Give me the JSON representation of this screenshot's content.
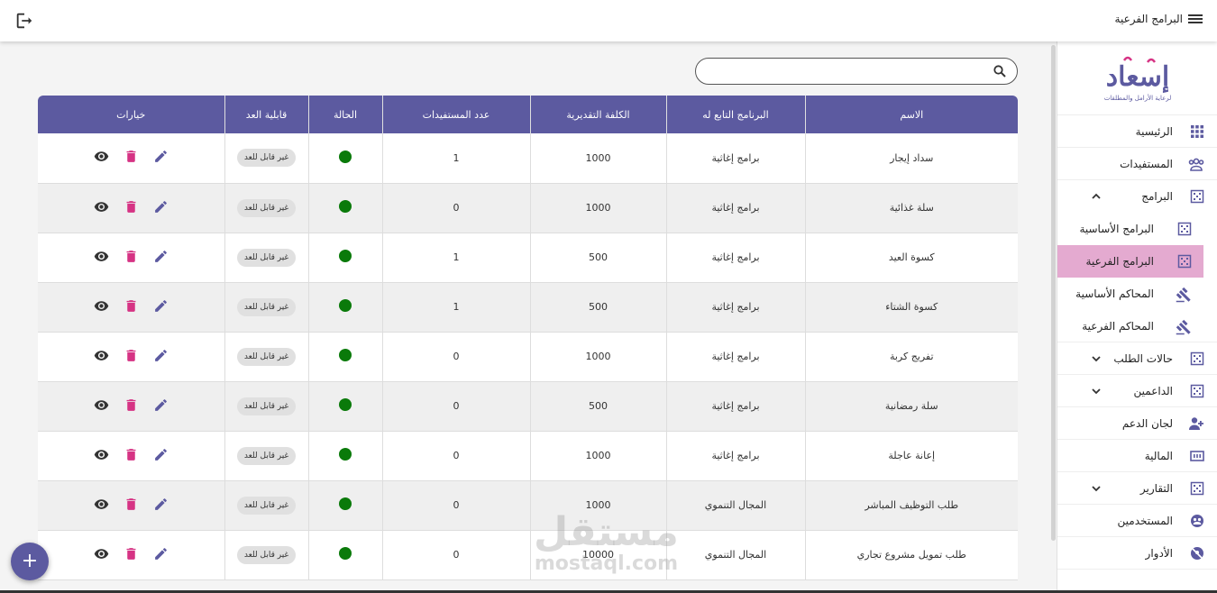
{
  "header": {
    "title": "البرامج الفرعية",
    "menu_icon": "menu-icon",
    "logout_icon": "logout-icon"
  },
  "sidebar": {
    "logo_text": "إسعاد",
    "logo_subtitle": "لرعاية الأرامل والمطلقات",
    "items": [
      {
        "label": "الرئيسية",
        "icon": "apps-grid-icon"
      },
      {
        "label": "المستفيدات",
        "icon": "group-icon"
      },
      {
        "label": "البرامج",
        "icon": "programs-icon"
      },
      {
        "label": "البرامج الأساسية",
        "icon": "programs-icon"
      },
      {
        "label": "البرامج الفرعية",
        "icon": "programs-icon"
      },
      {
        "label": "المحاكم الأساسية",
        "icon": "gavel-icon"
      },
      {
        "label": "المحاكم الفرعية",
        "icon": "gavel-icon"
      },
      {
        "label": "حالات الطلب",
        "icon": "programs-icon"
      },
      {
        "label": "الداعمين",
        "icon": "programs-icon"
      },
      {
        "label": "لجان الدعم",
        "icon": "person-add-icon"
      },
      {
        "label": "المالية",
        "icon": "finance-icon"
      },
      {
        "label": "التقارير",
        "icon": "programs-icon"
      },
      {
        "label": "المستخدمين",
        "icon": "users-icon"
      },
      {
        "label": "الأدوار",
        "icon": "roles-icon"
      }
    ]
  },
  "search": {
    "placeholder": "",
    "value": ""
  },
  "table": {
    "headers": [
      "الاسم",
      "البرنامج التابع له",
      "الكلفة التقديرية",
      "عدد المستفيدات",
      "الحالة",
      "قابلية العد",
      "خيارات"
    ],
    "rows": [
      {
        "name": "سداد إيجار",
        "program": "برامج إغاثية",
        "cost": "1000",
        "beneficiaries": "1",
        "countable": "غير قابل للعد"
      },
      {
        "name": "سلة غذائية",
        "program": "برامج إغاثية",
        "cost": "1000",
        "beneficiaries": "0",
        "countable": "غير قابل للعد"
      },
      {
        "name": "كسوة العيد",
        "program": "برامج إغاثية",
        "cost": "500",
        "beneficiaries": "1",
        "countable": "غير قابل للعد"
      },
      {
        "name": "كسوة الشتاء",
        "program": "برامج إغاثية",
        "cost": "500",
        "beneficiaries": "1",
        "countable": "غير قابل للعد"
      },
      {
        "name": "تفريج كربة",
        "program": "برامج إغاثية",
        "cost": "1000",
        "beneficiaries": "0",
        "countable": "غير قابل للعد"
      },
      {
        "name": "سلة رمضانية",
        "program": "برامج إغاثية",
        "cost": "500",
        "beneficiaries": "0",
        "countable": "غير قابل للعد"
      },
      {
        "name": "إعانة عاجلة",
        "program": "برامج إغاثية",
        "cost": "1000",
        "beneficiaries": "0",
        "countable": "غير قابل للعد"
      },
      {
        "name": "طلب التوظيف المباشر",
        "program": "المجال التنموي",
        "cost": "1000",
        "beneficiaries": "0",
        "countable": "غير قابل للعد"
      },
      {
        "name": "طلب تمويل مشروع تجاري",
        "program": "المجال التنموي",
        "cost": "10000",
        "beneficiaries": "0",
        "countable": "غير قابل للعد"
      }
    ]
  },
  "fab": {
    "label": "+"
  },
  "watermark": {
    "arabic": "مستقل",
    "latin": "mostaql.com"
  },
  "colors": {
    "header_bg": "#5c5aa0",
    "active_item_bg": "#e4aad0",
    "status_active": "#0a7a0a",
    "edit_icon": "#5c5aa0",
    "delete_icon": "#d63384",
    "view_icon": "#333333"
  }
}
